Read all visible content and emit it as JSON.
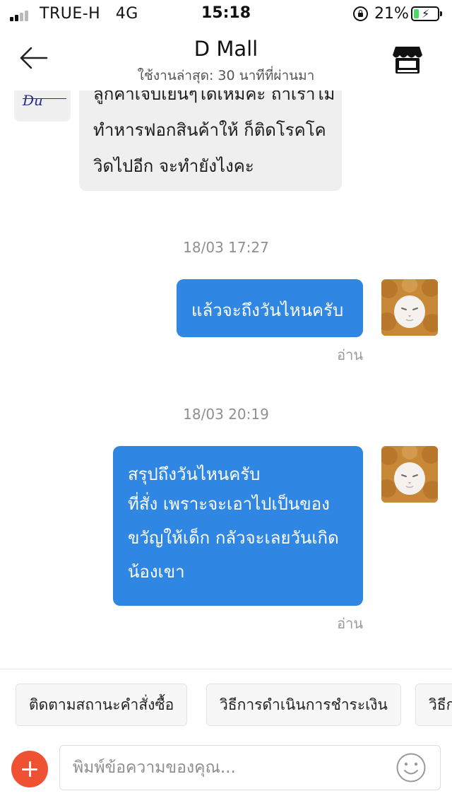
{
  "status_bar": {
    "carrier": "TRUE-H",
    "network": "4G",
    "time": "15:18",
    "battery_percent": "21%",
    "battery_level": 0.21,
    "signal_bars_active": 2,
    "icons": [
      "signal-bars-icon",
      "orientation-lock-icon",
      "battery-charging-icon"
    ]
  },
  "header": {
    "title": "D Mall",
    "subtitle": "ใช้งานล่าสุด: 30 นาทีที่ผ่านมา",
    "icons": [
      "back-arrow-icon",
      "store-icon"
    ]
  },
  "messages": [
    {
      "direction": "incoming",
      "lines": [
        "ลูกค้าเจ็บเยนๆได้เหมค่ะ ถ้าเราไม่",
        "ทำหารฟอกสินค้าให้ ก็ติดโรคโค",
        "วิดไปอีก จะทำยังไงคะ"
      ]
    },
    {
      "direction": "outgoing",
      "timestamp": "18/03 17:27",
      "lines": [
        "แล้วจะถึงวันไหนครับ"
      ],
      "status": "อ่าน"
    },
    {
      "direction": "outgoing",
      "timestamp": "18/03 20:19",
      "lines": [
        "สรุปถึงวันไหนครับ",
        "ที่สั่ง เพราะจะเอาไปเป็นของ",
        "ขวัญให้เด็ก กลัวจะเลยวันเกิด",
        "น้องเขา"
      ],
      "status": "อ่าน"
    }
  ],
  "quick_replies": [
    "ติดตามสถานะคำสั่งซื้อ",
    "วิธีการดำเนินการชำระเงิน",
    "วิธีก"
  ],
  "composer": {
    "placeholder": "พิมพ์ข้อความของคุณ...",
    "icons": [
      "add-icon",
      "emoji-icon"
    ]
  },
  "colors": {
    "outgoing_bubble": "#2f86e3",
    "incoming_bubble": "#efefef",
    "add_button": "#ef5233",
    "battery_fill": "#4cd964"
  }
}
